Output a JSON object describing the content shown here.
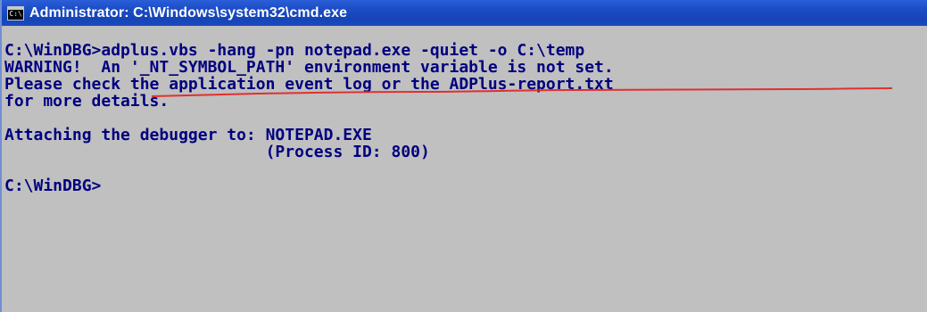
{
  "window": {
    "title": "Administrator: C:\\Windows\\system32\\cmd.exe",
    "icon": "cmd-icon",
    "icon_glyph": "C:\\"
  },
  "console": {
    "background": "#c0c0c0",
    "text_color": "#000080",
    "annotation_color": "#e03030",
    "lines": [
      "C:\\WinDBG>adplus.vbs -hang -pn notepad.exe -quiet -o C:\\temp",
      "WARNING!  An '_NT_SYMBOL_PATH' environment variable is not set.",
      "Please check the application event log or the ADPlus-report.txt",
      "for more details.",
      "",
      "Attaching the debugger to: NOTEPAD.EXE",
      "                           (Process ID: 800)",
      "",
      "C:\\WinDBG>"
    ]
  }
}
